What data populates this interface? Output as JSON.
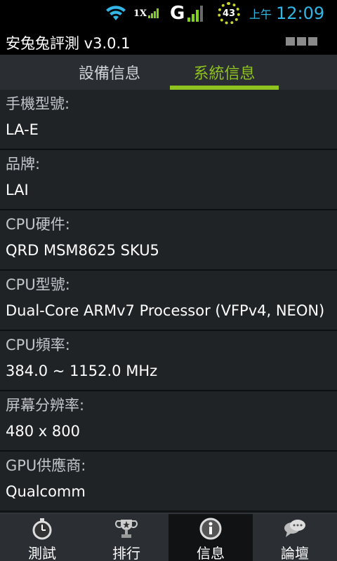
{
  "status_bar": {
    "network_1x": "1X",
    "network_g": "G",
    "battery_level": "43",
    "ampm": "上午",
    "time": "12:09",
    "accent_color": "#33b5e5"
  },
  "app": {
    "title": "安兔兔評測 v3.0.1"
  },
  "tabs": [
    {
      "label": "設備信息",
      "selected": false
    },
    {
      "label": "系統信息",
      "selected": true
    }
  ],
  "info_items": [
    {
      "label": "手機型號:",
      "value": "LA-E"
    },
    {
      "label": "品牌:",
      "value": "LAI"
    },
    {
      "label": "CPU硬件:",
      "value": "QRD MSM8625 SKU5"
    },
    {
      "label": "CPU型號:",
      "value": "Dual-Core ARMv7 Processor (VFPv4, NEON)"
    },
    {
      "label": "CPU頻率:",
      "value": "384.0 ~ 1152.0 MHz"
    },
    {
      "label": "屏幕分辨率:",
      "value": "480 x 800"
    },
    {
      "label": "GPU供應商:",
      "value": "Qualcomm"
    }
  ],
  "bottom_nav": [
    {
      "label": "測試",
      "icon": "stopwatch-icon",
      "active": false
    },
    {
      "label": "排行",
      "icon": "trophy-icon",
      "active": false
    },
    {
      "label": "信息",
      "icon": "info-icon",
      "active": true
    },
    {
      "label": "論壇",
      "icon": "chat-bubble-icon",
      "active": false
    }
  ],
  "colors": {
    "tab_selected": "#8fc31f",
    "signal_green": "#7ed31a",
    "battery_ring": "#c8d62a"
  }
}
